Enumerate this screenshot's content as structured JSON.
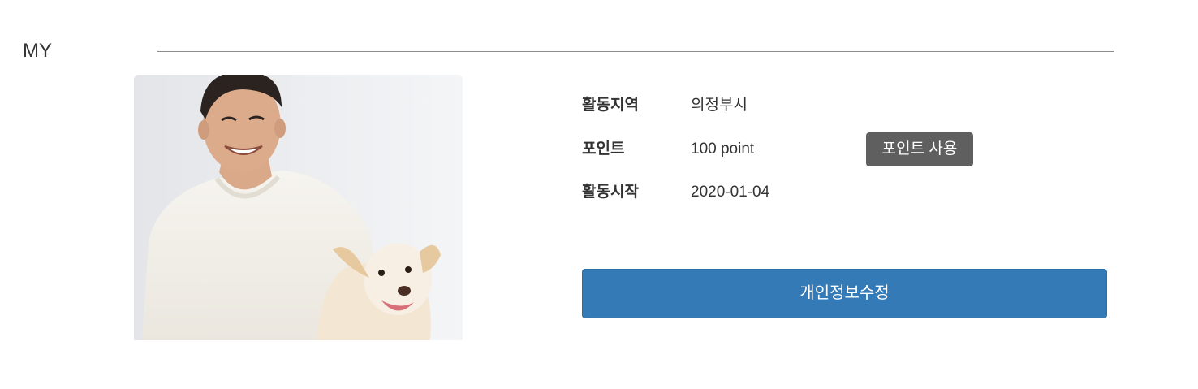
{
  "section": {
    "title": "MY"
  },
  "profile": {
    "photo_alt": "smiling man in white sweater with a white dog"
  },
  "info": {
    "region": {
      "label": "활동지역",
      "value": "의정부시"
    },
    "points": {
      "label": "포인트",
      "value": "100 point",
      "button_label": "포인트 사용"
    },
    "start": {
      "label": "활동시작",
      "value": "2020-01-04"
    }
  },
  "actions": {
    "edit_label": "개인정보수정"
  },
  "colors": {
    "primary": "#337ab7",
    "secondary_button": "#5f5f5f",
    "rule": "#8c8c8c",
    "text": "#333333"
  }
}
